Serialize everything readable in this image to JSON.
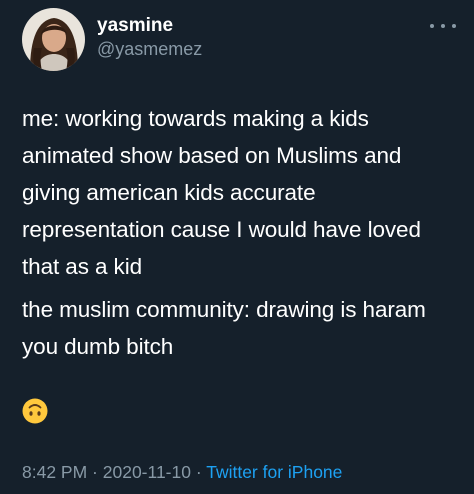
{
  "user": {
    "display_name": "yasmine",
    "handle": "@yasmemez"
  },
  "tweet": {
    "paragraph_1": "me: working towards making a kids animated show based on Muslims and giving american kids accurate representation cause I would have loved that as a kid",
    "paragraph_2": "the muslim community: drawing is haram you dumb bitch",
    "emoji": "upside-down-face-emoji"
  },
  "meta": {
    "time": "8:42 PM",
    "separator_1": " · ",
    "date": "2020-11-10",
    "separator_2": " · ",
    "source": "Twitter for iPhone"
  },
  "icons": {
    "more": "more-horizontal-icon"
  },
  "colors": {
    "background": "#15202b",
    "text": "#ffffff",
    "secondary": "#8899a6",
    "link": "#1da1f2",
    "emoji": "#ffc83d"
  }
}
